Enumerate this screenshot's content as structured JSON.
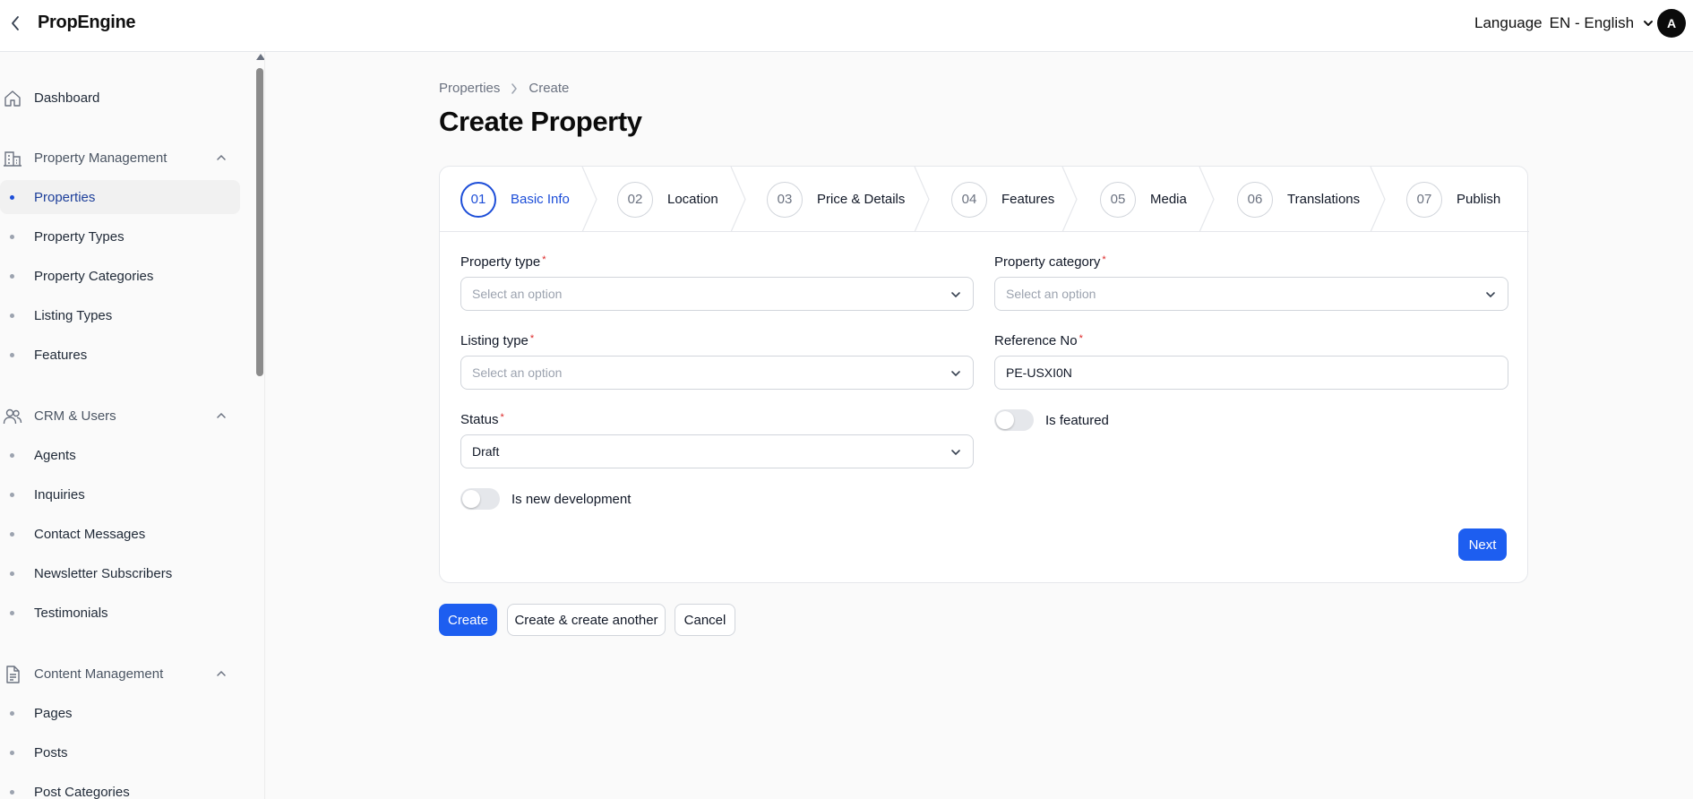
{
  "app": {
    "brand": "PropEngine"
  },
  "header": {
    "language_label": "Language",
    "language_value": "EN - English",
    "avatar_initial": "A"
  },
  "sidebar": {
    "dashboard": "Dashboard",
    "groups": [
      {
        "label": "Property Management",
        "items": [
          "Properties",
          "Property Types",
          "Property Categories",
          "Listing Types",
          "Features"
        ]
      },
      {
        "label": "CRM & Users",
        "items": [
          "Agents",
          "Inquiries",
          "Contact Messages",
          "Newsletter Subscribers",
          "Testimonials"
        ]
      },
      {
        "label": "Content Management",
        "items": [
          "Pages",
          "Posts",
          "Post Categories"
        ]
      }
    ],
    "active_item": "Properties"
  },
  "breadcrumb": {
    "parent": "Properties",
    "current": "Create"
  },
  "page": {
    "title": "Create Property"
  },
  "stepper": {
    "steps": [
      {
        "num": "01",
        "label": "Basic Info"
      },
      {
        "num": "02",
        "label": "Location"
      },
      {
        "num": "03",
        "label": "Price & Details"
      },
      {
        "num": "04",
        "label": "Features"
      },
      {
        "num": "05",
        "label": "Media"
      },
      {
        "num": "06",
        "label": "Translations"
      },
      {
        "num": "07",
        "label": "Publish"
      }
    ],
    "current": "01"
  },
  "form": {
    "property_type": {
      "label": "Property type",
      "required_mark": "*",
      "placeholder": "Select an option"
    },
    "property_category": {
      "label": "Property category",
      "required_mark": "*",
      "placeholder": "Select an option"
    },
    "listing_type": {
      "label": "Listing type",
      "required_mark": "*",
      "placeholder": "Select an option"
    },
    "reference_no": {
      "label": "Reference No",
      "required_mark": "*",
      "value": "PE-USXI0N"
    },
    "status": {
      "label": "Status",
      "required_mark": "*",
      "value": "Draft"
    },
    "is_featured": {
      "label": "Is featured",
      "on": false
    },
    "is_new_development": {
      "label": "Is new development",
      "on": false
    },
    "next_label": "Next"
  },
  "actions": {
    "create": "Create",
    "create_another": "Create & create another",
    "cancel": "Cancel"
  },
  "colors": {
    "primary": "#1d5ef0",
    "active_text": "#1d3f9a",
    "required": "#dc2626"
  }
}
